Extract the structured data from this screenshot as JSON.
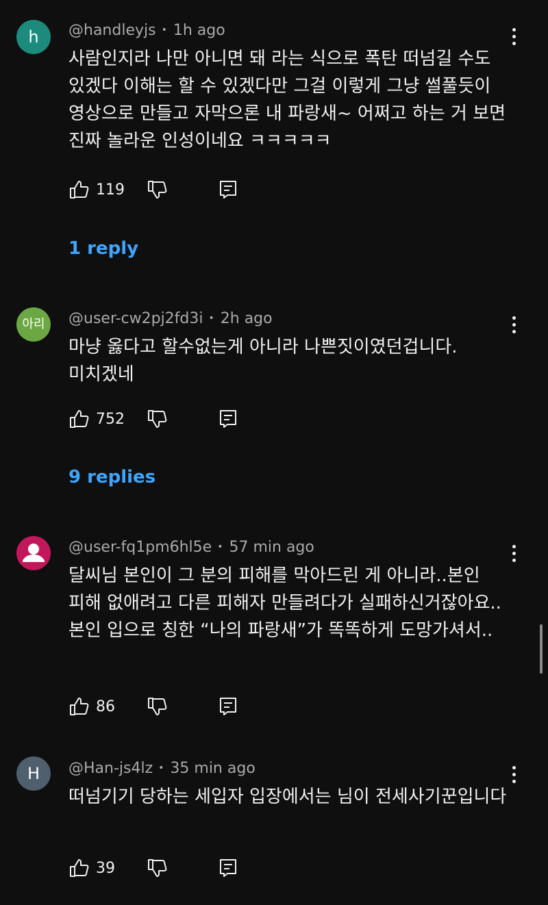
{
  "comments": [
    {
      "avatar_letter": "h",
      "avatar_color": "#1d8a7e",
      "handle": "@handleyjs",
      "time": "1h ago",
      "text": "사람인지라 나만 아니면 돼 라는 식으로 폭탄 떠넘길 수도 있겠다 이해는 할 수 있겠다만 그걸 이렇게 그냥 썰풀듯이 영상으로 만들고 자막으론 내 파랑새~ 어쩌고 하는 거 보면 진짜 놀라운 인성이네요 ㅋㅋㅋㅋㅋ",
      "likes": "119",
      "replies_label": "1 reply"
    },
    {
      "avatar_letter": "아리",
      "avatar_color": "#6ba843",
      "handle": "@user-cw2pj2fd3i",
      "time": "2h ago",
      "text": "마냥 옳다고 할수없는게 아니라 나쁜짓이였던겁니다. 미치겠네",
      "likes": "752",
      "replies_label": "9 replies"
    },
    {
      "avatar_icon": "person-icon",
      "avatar_color": "#c2185b",
      "handle": "@user-fq1pm6hl5e",
      "time": "57 min ago",
      "text": "달씨님 본인이 그 분의 피해를 막아드린 게 아니라..본인 피해 없애려고 다른 피해자 만들려다가 실패하신거잖아요..본인 입으로 칭한 “나의 파랑새”가 똑똑하게 도망가셔서..",
      "likes": "86"
    },
    {
      "avatar_letter": "H",
      "avatar_color": "#4f5f6d",
      "handle": "@Han-js4lz",
      "time": "35 min ago",
      "text": "떠넘기기 당하는 세입자 입장에서는 님이 전세사기꾼입니다",
      "likes": "39"
    }
  ],
  "colors": {
    "background": "#0f0f0f",
    "primary_text": "#f1f1f1",
    "secondary_text": "#aaaaaa",
    "link_blue": "#3ea6ff"
  },
  "icons": {
    "like": "thumbs-up-icon",
    "dislike": "thumbs-down-icon",
    "reply": "reply-comment-icon",
    "more": "more-vertical-icon"
  }
}
